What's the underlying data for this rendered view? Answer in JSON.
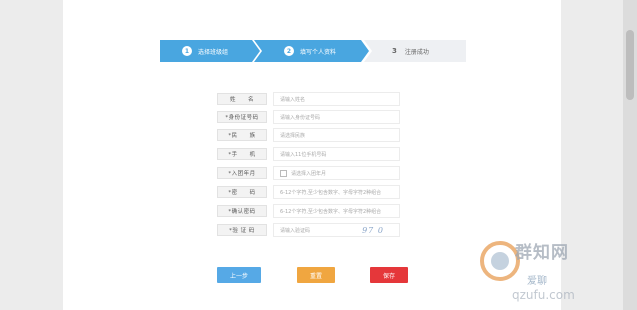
{
  "steps": [
    {
      "num": "1",
      "label": "选择班级组"
    },
    {
      "num": "2",
      "label": "填写个人资料"
    },
    {
      "num": "3",
      "label": "注册成功"
    }
  ],
  "form": {
    "rows": [
      {
        "label": "姓　　名",
        "placeholder": "请输入姓名"
      },
      {
        "label": "*身份证号码",
        "placeholder": "请输入身份证号码"
      },
      {
        "label": "*民　　族",
        "placeholder": "请选择民族"
      },
      {
        "label": "*手　　机",
        "placeholder": "请输入11位手机号码"
      },
      {
        "label": "*入团年月",
        "placeholder": "请选择入团年月"
      },
      {
        "label": "*密　　码",
        "placeholder": "6-12个字符,至少包含数字、字母字符2种组合"
      },
      {
        "label": "*确认密码",
        "placeholder": "6-12个字符,至少包含数字、字母字符2种组合"
      },
      {
        "label": "*验 证 码",
        "placeholder": "请输入验证码"
      }
    ],
    "captcha_text": "97 0"
  },
  "buttons": {
    "prev": "上一步",
    "reset": "重置",
    "save": "保存"
  },
  "watermark": {
    "line1": "群知网",
    "line2": "爱聊",
    "line3": "qzufu.com"
  },
  "colors": {
    "step_active": "#49a6e0",
    "btn_prev": "#56a9e6",
    "btn_reset": "#f0a640",
    "btn_save": "#e5373a"
  }
}
